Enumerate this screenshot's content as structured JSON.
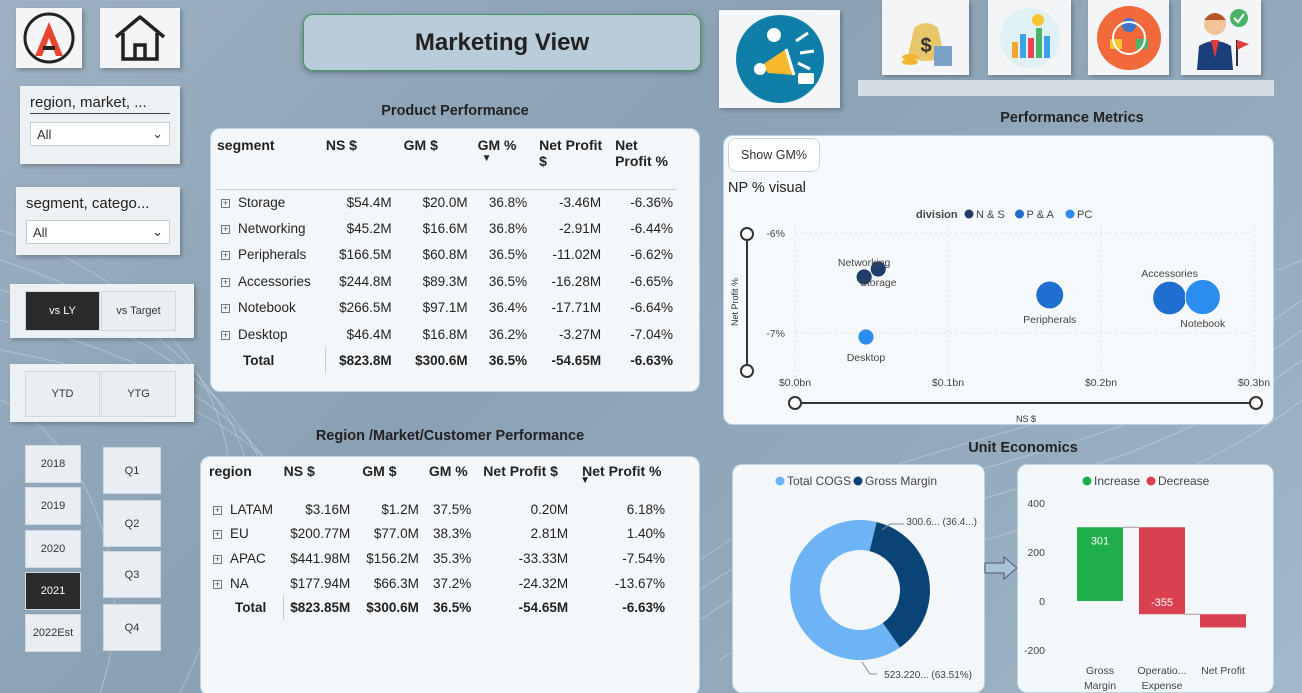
{
  "title": "Marketing View",
  "slicers": {
    "region": {
      "label": "region, market, ...",
      "value": "All"
    },
    "segment": {
      "label": "segment, catego...",
      "value": "All"
    }
  },
  "compare_buttons": [
    {
      "label": "vs LY",
      "active": true
    },
    {
      "label": "vs Target",
      "active": false
    }
  ],
  "period_buttons": [
    "YTD",
    "YTG"
  ],
  "years": [
    {
      "label": "2018",
      "active": false
    },
    {
      "label": "2019",
      "active": false
    },
    {
      "label": "2020",
      "active": false
    },
    {
      "label": "2021",
      "active": true
    },
    {
      "label": "2022Est",
      "active": false
    }
  ],
  "quarters": [
    "Q1",
    "Q2",
    "Q3",
    "Q4"
  ],
  "top_icons": [
    "finance-icon",
    "sales-chart-icon",
    "supply-chain-icon",
    "executive-icon"
  ],
  "product_performance": {
    "title": "Product Performance",
    "headers": [
      "segment",
      "NS $",
      "GM $",
      "GM %",
      "Net Profit $",
      "Net Profit %"
    ],
    "rows": [
      [
        "Storage",
        "$54.4M",
        "$20.0M",
        "36.8%",
        "-3.46M",
        "-6.36%"
      ],
      [
        "Networking",
        "$45.2M",
        "$16.6M",
        "36.8%",
        "-2.91M",
        "-6.44%"
      ],
      [
        "Peripherals",
        "$166.5M",
        "$60.8M",
        "36.5%",
        "-11.02M",
        "-6.62%"
      ],
      [
        "Accessories",
        "$244.8M",
        "$89.3M",
        "36.5%",
        "-16.28M",
        "-6.65%"
      ],
      [
        "Notebook",
        "$266.5M",
        "$97.1M",
        "36.4%",
        "-17.71M",
        "-6.64%"
      ],
      [
        "Desktop",
        "$46.4M",
        "$16.8M",
        "36.2%",
        "-3.27M",
        "-7.04%"
      ]
    ],
    "total": [
      "Total",
      "$823.8M",
      "$300.6M",
      "36.5%",
      "-54.65M",
      "-6.63%"
    ]
  },
  "region_performance": {
    "title": "Region /Market/Customer Performance",
    "headers": [
      "region",
      "NS $",
      "GM $",
      "GM %",
      "Net Profit $",
      "Net Profit %"
    ],
    "rows": [
      [
        "LATAM",
        "$3.16M",
        "$1.2M",
        "37.5%",
        "0.20M",
        "6.18%"
      ],
      [
        "EU",
        "$200.77M",
        "$77.0M",
        "38.3%",
        "2.81M",
        "1.40%"
      ],
      [
        "APAC",
        "$441.98M",
        "$156.2M",
        "35.3%",
        "-33.33M",
        "-7.54%"
      ],
      [
        "NA",
        "$177.94M",
        "$66.3M",
        "37.2%",
        "-24.32M",
        "-13.67%"
      ]
    ],
    "total": [
      "Total",
      "$823.85M",
      "$300.6M",
      "36.5%",
      "-54.65M",
      "-6.63%"
    ]
  },
  "performance_metrics": {
    "title": "Performance Metrics",
    "show_button": "Show GM%",
    "visual_title": "NP % visual"
  },
  "unit_economics": {
    "title": "Unit Economics"
  },
  "colors": {
    "ns": "#1f3d6b",
    "pa": "#1e6fd0",
    "pc": "#2b8df0",
    "cogs": "#6cb4f5",
    "gm": "#0a4476",
    "increase": "#1fae4b",
    "decrease": "#d94150"
  },
  "chart_data": [
    {
      "type": "scatter",
      "title": "NP % visual",
      "xlabel": "NS $",
      "ylabel": "Net Profit %",
      "legend_title": "division",
      "legend": [
        "N & S",
        "P & A",
        "PC"
      ],
      "x_ticks": [
        "$0.0bn",
        "$0.1bn",
        "$0.2bn",
        "$0.3bn"
      ],
      "y_ticks": [
        "-6%",
        "-7%"
      ],
      "xlim": [
        0,
        0.3
      ],
      "ylim": [
        -7.4,
        -5.9
      ],
      "points": [
        {
          "label": "Networking",
          "series": "N & S",
          "x": 0.0452,
          "y": -6.44
        },
        {
          "label": "Storage",
          "series": "N & S",
          "x": 0.0544,
          "y": -6.36
        },
        {
          "label": "Peripherals",
          "series": "P & A",
          "x": 0.1665,
          "y": -6.62
        },
        {
          "label": "Accessories",
          "series": "P & A",
          "x": 0.2448,
          "y": -6.65
        },
        {
          "label": "Notebook",
          "series": "PC",
          "x": 0.2665,
          "y": -6.64
        },
        {
          "label": "Desktop",
          "series": "PC",
          "x": 0.0464,
          "y": -7.04
        }
      ]
    },
    {
      "type": "pie",
      "legend": [
        "Total COGS",
        "Gross Margin"
      ],
      "slices": [
        {
          "name": "Total COGS",
          "value": 523.22,
          "percent": 63.51,
          "label": "523.220... (63.51%)"
        },
        {
          "name": "Gross Margin",
          "value": 300.6,
          "percent": 36.4,
          "label": "300.6... (36.4...)"
        }
      ]
    },
    {
      "type": "bar",
      "subtype": "waterfall",
      "legend": [
        "Increase",
        "Decrease"
      ],
      "categories": [
        "Gross Margin",
        "Operatio... Expense",
        "Net Profit"
      ],
      "values": [
        301,
        -355,
        -54
      ],
      "data_labels": [
        "301",
        "-355",
        ""
      ],
      "y_ticks": [
        "400",
        "200",
        "0",
        "-200"
      ],
      "ylim": [
        -240,
        430
      ]
    }
  ]
}
